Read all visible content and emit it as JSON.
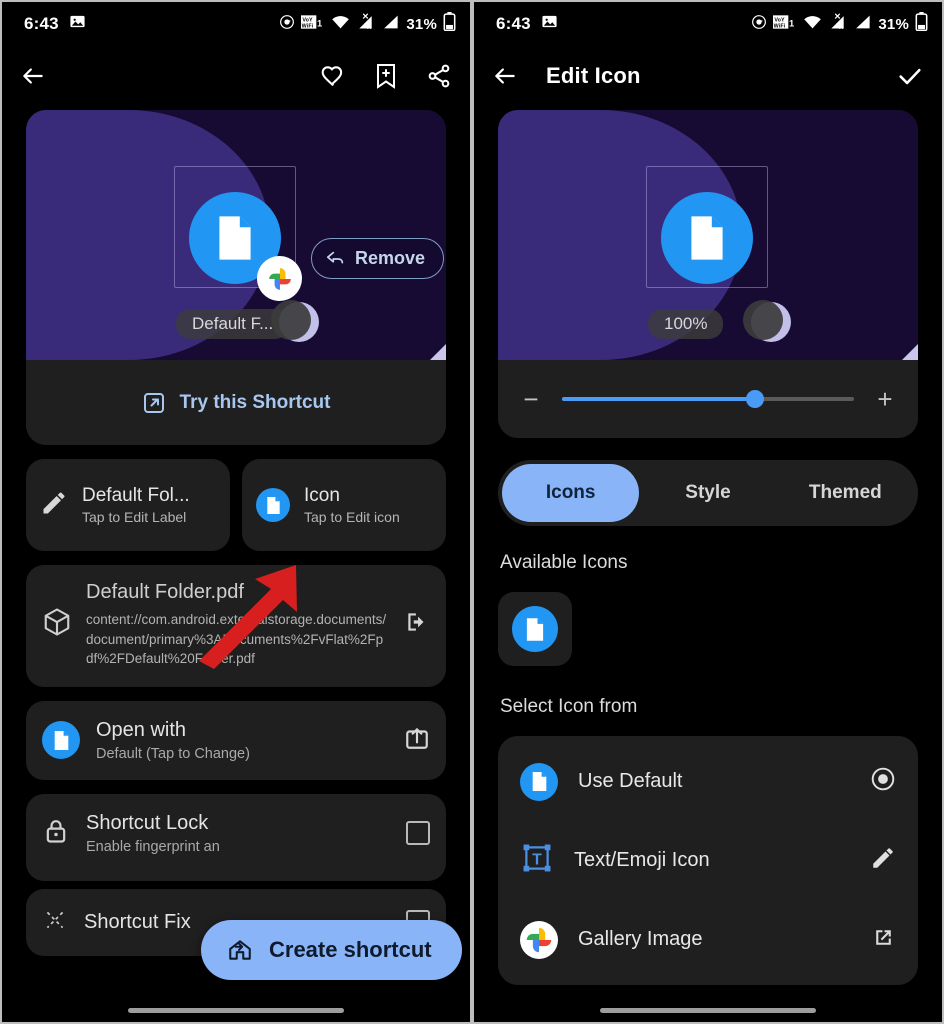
{
  "status_bar": {
    "time": "6:43",
    "battery_percent": "31%",
    "icons": [
      "image-icon",
      "alarm-icon",
      "vowifi-icon",
      "wifi-icon",
      "signal-x-icon",
      "signal-icon",
      "battery-icon"
    ]
  },
  "left": {
    "appbar": {
      "back": "back-arrow-icon",
      "favorite": "heart-icon",
      "bookmark": "bookmark-add-icon",
      "share": "share-icon"
    },
    "preview": {
      "shortcut_label": "Default F...",
      "remove_label": "Remove",
      "try_label": "Try this Shortcut"
    },
    "mini_cards": [
      {
        "title": "Default Fol...",
        "subtitle": "Tap to Edit Label",
        "icon": "pencil-icon"
      },
      {
        "title": "Icon",
        "subtitle": "Tap to Edit icon",
        "icon": "document-icon"
      }
    ],
    "uri_card": {
      "title": "Default Folder.pdf",
      "uri": "content://com.android.externalstorage.documents/document/primary%3ADocuments%2FvFlat%2Fpdf%2FDefault%20Folder.pdf",
      "leading_icon": "package-icon",
      "trailing_icon": "open-in-icon"
    },
    "open_with": {
      "title": "Open with",
      "subtitle": "Default (Tap to Change)",
      "trailing_icon": "launch-icon"
    },
    "shortcut_lock": {
      "title": "Shortcut Lock",
      "subtitle": "Enable fingerprint an",
      "leading_icon": "lock-icon"
    },
    "shortcut_fix": {
      "title": "Shortcut Fix",
      "leading_icon": "fix-icon"
    },
    "fab": {
      "label": "Create shortcut",
      "icon": "add-to-home-icon"
    }
  },
  "right": {
    "appbar": {
      "title": "Edit Icon",
      "back": "back-arrow-icon",
      "confirm": "check-icon"
    },
    "preview": {
      "scale_label": "100%"
    },
    "slider": {
      "minus": "−",
      "plus": "+",
      "value_percent": 66
    },
    "tabs": [
      {
        "label": "Icons",
        "active": true
      },
      {
        "label": "Style",
        "active": false
      },
      {
        "label": "Themed",
        "active": false
      }
    ],
    "available_icons_title": "Available Icons",
    "available_icons": [
      {
        "name": "document-icon"
      }
    ],
    "select_icon_title": "Select Icon from",
    "select_rows": [
      {
        "label": "Use Default",
        "leading_icon": "document-icon",
        "trailing_icon": "radio-selected-icon"
      },
      {
        "label": "Text/Emoji Icon",
        "leading_icon": "text-box-icon",
        "trailing_icon": "pencil-icon"
      },
      {
        "label": "Gallery Image",
        "leading_icon": "google-photos-icon",
        "trailing_icon": "open-in-new-icon"
      }
    ]
  },
  "annotation": {
    "arrow_color": "#d81f1f"
  },
  "colors": {
    "accent_blue": "#2196f3",
    "fab_blue": "#8ab4f8",
    "card_bg": "#1f1f1f",
    "screen_bg": "#000000",
    "wallpaper_light": "#3a2a7a",
    "wallpaper_dark": "#170a33"
  }
}
